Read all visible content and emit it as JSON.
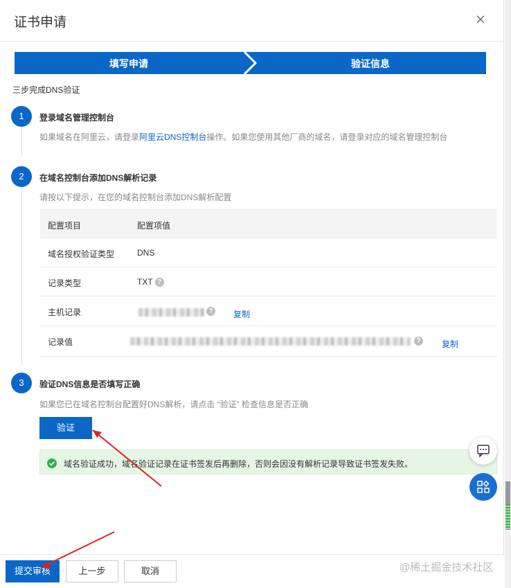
{
  "dialog": {
    "title": "证书申请"
  },
  "steps": [
    {
      "label": "填写申请"
    },
    {
      "label": "验证信息"
    }
  ],
  "intro": "三步完成DNS验证",
  "sections": [
    {
      "number": "1",
      "title": "登录域名管理控制台",
      "desc_before": "如果域名在阿里云，请登录",
      "desc_link": "阿里云DNS控制台",
      "desc_after": "操作。如果您使用其他厂商的域名，请登录对应的域名管理控制台"
    },
    {
      "number": "2",
      "title": "在域名控制台添加DNS解析记录",
      "desc": "请按以下提示，在您的域名控制台添加DNS解析配置"
    },
    {
      "number": "3",
      "title": "验证DNS信息是否填写正确",
      "desc": "如果您已在域名控制台配置好DNS解析，请点击 “验证” 检查信息是否正确"
    }
  ],
  "table": {
    "headers": [
      "配置项目",
      "配置项值"
    ],
    "rows": [
      {
        "key": "域名授权验证类型",
        "value": "DNS"
      },
      {
        "key": "记录类型",
        "value": "TXT"
      },
      {
        "key": "主机记录",
        "value": ""
      },
      {
        "key": "记录值",
        "value": ""
      }
    ],
    "copy_label": "复制",
    "help_glyph": "?"
  },
  "verify_button": "验证",
  "alert": {
    "text": "域名验证成功，域名验证记录在证书签发后再删除，否则会因没有解析记录导致证书签发失败。",
    "color": "#2bb24c"
  },
  "footer": {
    "submit": "提交审核",
    "prev": "上一步",
    "cancel": "取消"
  },
  "watermark": "@稀土掘金技术社区",
  "colors": {
    "primary": "#0a67c8",
    "success_bg": "#e6f6e4",
    "annotation": "#e02020"
  }
}
